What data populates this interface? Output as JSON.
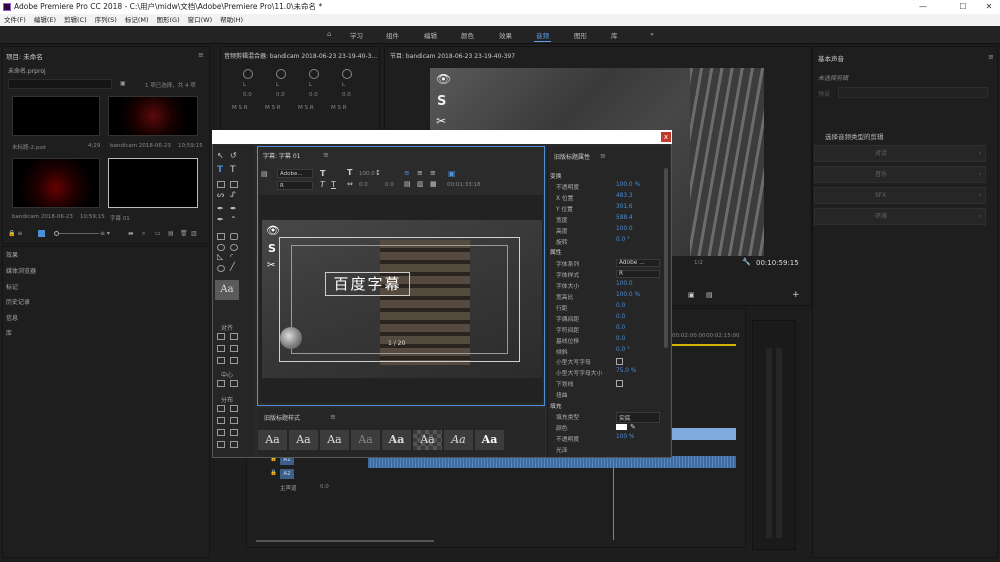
{
  "titlebar": {
    "title": "Adobe Premiere Pro CC 2018 - C:\\用户\\midw\\文档\\Adobe\\Premiere Pro\\11.0\\未命名 *"
  },
  "menu": [
    "文件(F)",
    "编辑(E)",
    "剪辑(C)",
    "序列(S)",
    "标记(M)",
    "图形(G)",
    "窗口(W)",
    "帮助(H)"
  ],
  "workspaces": [
    "学习",
    "组件",
    "编辑",
    "颜色",
    "效果",
    "音频",
    "图形",
    "库"
  ],
  "active_workspace": "音频",
  "project": {
    "title": "项目: 未命名",
    "file": "未命名.prproj",
    "selection": "1 项已选择，共 4 项",
    "items": [
      {
        "name": "未标题-2.psd",
        "dur": "4;29"
      },
      {
        "name": "bandicam 2018-06-23",
        "dur": "10;59;15"
      },
      {
        "name": "bandicam 2018-06-23",
        "dur": "10;59;15"
      },
      {
        "name": "字幕 01",
        "dur": ""
      }
    ]
  },
  "left_tabs": [
    "效果",
    "媒体浏览器",
    "标记",
    "历史记录",
    "信息",
    "库"
  ],
  "mixer": {
    "title": "音频剪辑混合器: bandicam 2018-06-23 23-19-40-3...",
    "ch": [
      "L",
      "L",
      "L",
      "L"
    ],
    "val": "0.0",
    "msr": "M S R"
  },
  "program": {
    "title": "节目: bandicam 2018-06-23 23-19-40-397",
    "fraction": "1/2",
    "timecode": "00:10:59:15"
  },
  "dialog": {
    "tab": "字幕: 字幕 01",
    "font": "Adobe...",
    "style": "R",
    "size": "100.0",
    "kerning": "0.0",
    "leading": "0.0",
    "timecode": "00:01:33:18",
    "caption": "百度字幕",
    "page": "1 / 20",
    "close": "x",
    "props_title": "旧版标题属性",
    "align_label": "对齐",
    "center_label": "中心",
    "dist_label": "分布",
    "styles_title": "旧版标题样式",
    "aa": "Aa",
    "props": [
      {
        "k": "变换",
        "v": "",
        "h": true
      },
      {
        "k": "不透明度",
        "v": "100.0 %"
      },
      {
        "k": "X 位置",
        "v": "483.3"
      },
      {
        "k": "Y 位置",
        "v": "301.6"
      },
      {
        "k": "宽度",
        "v": "588.4"
      },
      {
        "k": "高度",
        "v": "100.0"
      },
      {
        "k": "旋转",
        "v": "0.0 °"
      },
      {
        "k": "属性",
        "v": "",
        "h": true
      },
      {
        "k": "字体系列",
        "v": "Adobe ..."
      },
      {
        "k": "字体样式",
        "v": "R"
      },
      {
        "k": "字体大小",
        "v": "100.0"
      },
      {
        "k": "宽高比",
        "v": "100.0 %"
      },
      {
        "k": "行距",
        "v": "0.0"
      },
      {
        "k": "字偶间距",
        "v": "0.0"
      },
      {
        "k": "字符间距",
        "v": "0.0"
      },
      {
        "k": "基线位移",
        "v": "0.0"
      },
      {
        "k": "倾斜",
        "v": "0.0 °"
      },
      {
        "k": "小型大写字母",
        "v": ""
      },
      {
        "k": "小型大写字母大小",
        "v": "75.0 %"
      },
      {
        "k": "下划线",
        "v": ""
      },
      {
        "k": "扭曲",
        "v": ""
      },
      {
        "k": "填充",
        "v": "",
        "h": true
      },
      {
        "k": "填充类型",
        "v": "实底"
      },
      {
        "k": "颜色",
        "v": ""
      },
      {
        "k": "不透明度",
        "v": "100 %"
      },
      {
        "k": "光泽",
        "v": ""
      },
      {
        "k": "纹理",
        "v": ""
      }
    ]
  },
  "timeline": {
    "t1": "00:02:00:00",
    "t2": "00:02:15:00",
    "a1": "A1",
    "a2": "A2",
    "master": "主声道",
    "mval": "0.0"
  },
  "essential_sound": {
    "title": "基本声音",
    "unselected": "未选择剪辑",
    "preset": "预设",
    "prompt": "选择音频类型的剪辑",
    "types": [
      "对话",
      "音乐",
      "SFX",
      "环境"
    ]
  },
  "colors": {
    "accent": "#5aa0e8",
    "close_red": "#c0392b"
  }
}
